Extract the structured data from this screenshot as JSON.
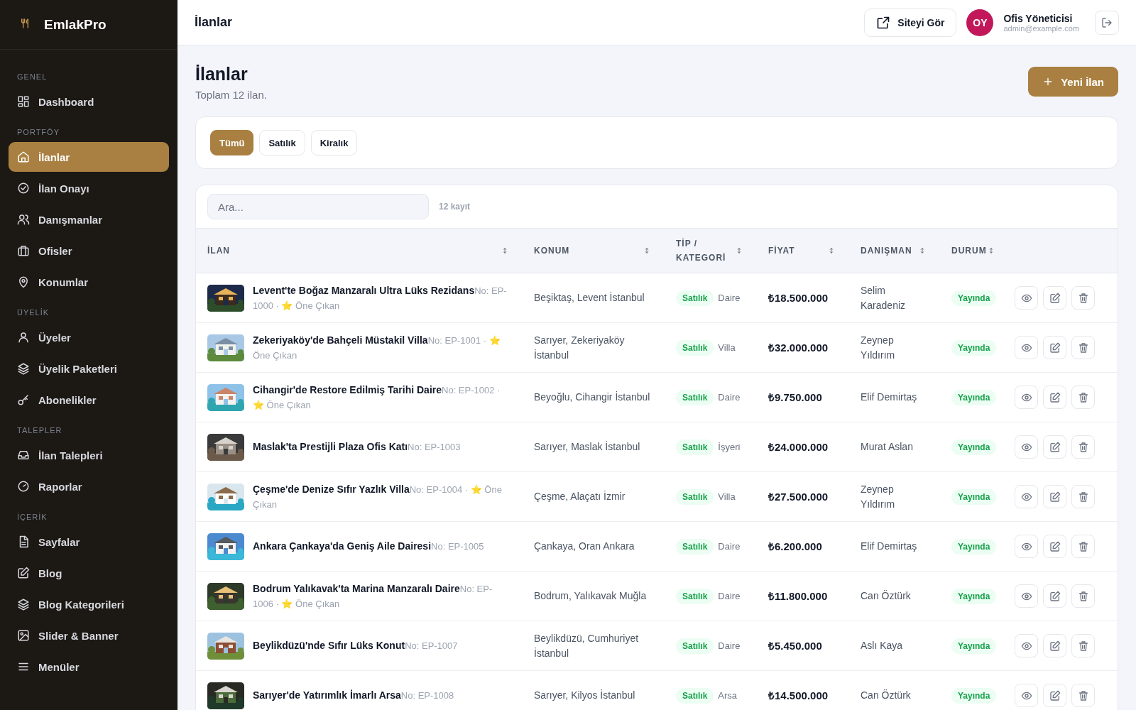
{
  "brand": {
    "name": "EmlakPro"
  },
  "sidebar": {
    "sections": [
      {
        "title": "GENEL",
        "items": [
          {
            "label": "Dashboard",
            "selected": false
          }
        ]
      },
      {
        "title": "PORTFÖY",
        "items": [
          {
            "label": "İlanlar",
            "selected": true
          },
          {
            "label": "İlan Onayı",
            "selected": false
          },
          {
            "label": "Danışmanlar",
            "selected": false
          },
          {
            "label": "Ofisler",
            "selected": false
          },
          {
            "label": "Konumlar",
            "selected": false
          }
        ]
      },
      {
        "title": "ÜYELİK",
        "items": [
          {
            "label": "Üyeler",
            "selected": false
          },
          {
            "label": "Üyelik Paketleri",
            "selected": false
          },
          {
            "label": "Abonelikler",
            "selected": false
          }
        ]
      },
      {
        "title": "TALEPLER",
        "items": [
          {
            "label": "İlan Talepleri",
            "selected": false
          },
          {
            "label": "Raporlar",
            "selected": false
          }
        ]
      },
      {
        "title": "İÇERİK",
        "items": [
          {
            "label": "Sayfalar",
            "selected": false
          },
          {
            "label": "Blog",
            "selected": false
          },
          {
            "label": "Blog Kategorileri",
            "selected": false
          },
          {
            "label": "Slider & Banner",
            "selected": false
          },
          {
            "label": "Menüler",
            "selected": false
          }
        ]
      }
    ]
  },
  "topbar": {
    "title": "İlanlar",
    "view_site": "Siteyi Gör",
    "user": {
      "initials": "OY",
      "name": "Ofis Yöneticisi",
      "email": "admin@example.com"
    }
  },
  "page": {
    "title": "İlanlar",
    "subtitle": "Toplam 12 ilan.",
    "new_button": "Yeni İlan"
  },
  "filters": [
    {
      "label": "Tümü",
      "selected": true
    },
    {
      "label": "Satılık",
      "selected": false
    },
    {
      "label": "Kiralık",
      "selected": false
    }
  ],
  "search": {
    "placeholder": "Ara...",
    "count": "12 kayıt"
  },
  "table": {
    "columns": [
      "İLAN",
      "KONUM",
      "TİP / KATEGORİ",
      "FİYAT",
      "DANIŞMAN",
      "DURUM"
    ],
    "rows": [
      {
        "title": "Levent'te Boğaz Manzaralı Ultra Lüks Rezidans",
        "no": "No: EP-1000",
        "tag": "· ⭐ Öne Çıkan",
        "location": "Beşiktaş, Levent İstanbul",
        "type": "Satılık",
        "category": "Daire",
        "price": "₺18.500.000",
        "agent": "Selim Karadeniz",
        "status": "Yayında"
      },
      {
        "title": "Zekeriyaköy'de Bahçeli Müstakil Villa",
        "no": "No: EP-1001",
        "tag": "· ⭐ Öne Çıkan",
        "location": "Sarıyer, Zekeriyaköy İstanbul",
        "type": "Satılık",
        "category": "Villa",
        "price": "₺32.000.000",
        "agent": "Zeynep Yıldırım",
        "status": "Yayında"
      },
      {
        "title": "Cihangir'de Restore Edilmiş Tarihi Daire",
        "no": "No: EP-1002",
        "tag": "· ⭐ Öne Çıkan",
        "location": "Beyoğlu, Cihangir İstanbul",
        "type": "Satılık",
        "category": "Daire",
        "price": "₺9.750.000",
        "agent": "Elif Demirtaş",
        "status": "Yayında"
      },
      {
        "title": "Maslak'ta Prestijli Plaza Ofis Katı",
        "no": "No: EP-1003",
        "location": "Sarıyer, Maslak İstanbul",
        "type": "Satılık",
        "category": "İşyeri",
        "price": "₺24.000.000",
        "agent": "Murat Aslan",
        "status": "Yayında"
      },
      {
        "title": "Çeşme'de Denize Sıfır Yazlık Villa",
        "no": "No: EP-1004",
        "tag": "· ⭐ Öne Çıkan",
        "location": "Çeşme, Alaçatı İzmir",
        "type": "Satılık",
        "category": "Villa",
        "price": "₺27.500.000",
        "agent": "Zeynep Yıldırım",
        "status": "Yayında"
      },
      {
        "title": "Ankara Çankaya'da Geniş Aile Dairesi",
        "no": "No: EP-1005",
        "location": "Çankaya, Oran Ankara",
        "type": "Satılık",
        "category": "Daire",
        "price": "₺6.200.000",
        "agent": "Elif Demirtaş",
        "status": "Yayında"
      },
      {
        "title": "Bodrum Yalıkavak'ta Marina Manzaralı Daire",
        "no": "No: EP-1006",
        "tag": "· ⭐ Öne Çıkan",
        "location": "Bodrum, Yalıkavak Muğla",
        "type": "Satılık",
        "category": "Daire",
        "price": "₺11.800.000",
        "agent": "Can Öztürk",
        "status": "Yayında"
      },
      {
        "title": "Beylikdüzü'nde Sıfır Lüks Konut",
        "no": "No: EP-1007",
        "location": "Beylikdüzü, Cumhuriyet İstanbul",
        "type": "Satılık",
        "category": "Daire",
        "price": "₺5.450.000",
        "agent": "Aslı Kaya",
        "status": "Yayında"
      },
      {
        "title": "Sarıyer'de Yatırımlık İmarlı Arsa",
        "no": "No: EP-1008",
        "location": "Sarıyer, Kilyos İstanbul",
        "type": "Satılık",
        "category": "Arsa",
        "price": "₺14.500.000",
        "agent": "Can Öztürk",
        "status": "Yayında"
      }
    ]
  }
}
